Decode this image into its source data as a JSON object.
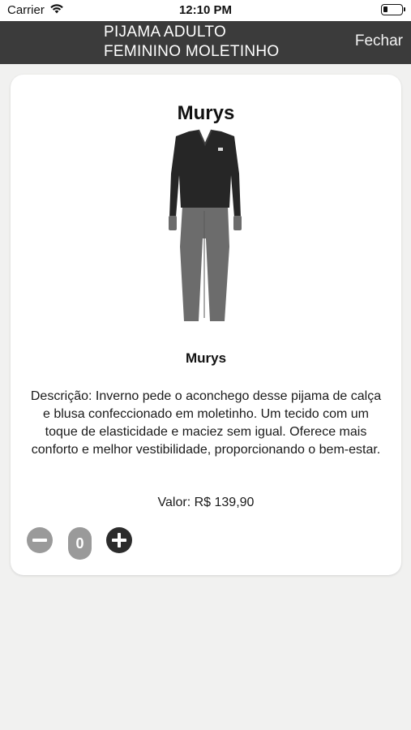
{
  "status_bar": {
    "carrier": "Carrier",
    "time": "12:10 PM",
    "battery_level": 0.25,
    "icons": [
      "wifi-icon",
      "battery-icon"
    ]
  },
  "nav": {
    "title_line1": "PIJAMA ADULTO",
    "title_line2": "FEMININO MOLETINHO",
    "close_label": "Fechar"
  },
  "product": {
    "heading": "Murys",
    "name": "Murys",
    "image_icon": "pajama-image",
    "description": "Descrição: Inverno pede o aconchego desse pijama de calça e blusa confeccionado em moletinho. Um tecido com um toque de elasticidade e maciez sem igual. Oferece mais conforto e melhor vestibilidade, proporcionando o bem-estar.",
    "price": "Valor: R$ 139,90"
  },
  "quantity": {
    "value": "0",
    "decrement_icon": "minus-circle-icon",
    "increment_icon": "plus-circle-icon"
  },
  "colors": {
    "nav_bg": "#3b3b3b",
    "card_bg": "#ffffff",
    "page_bg": "#f1f1f0",
    "minus_bg": "#9a9a9a",
    "plus_bg": "#2c2c2c"
  }
}
